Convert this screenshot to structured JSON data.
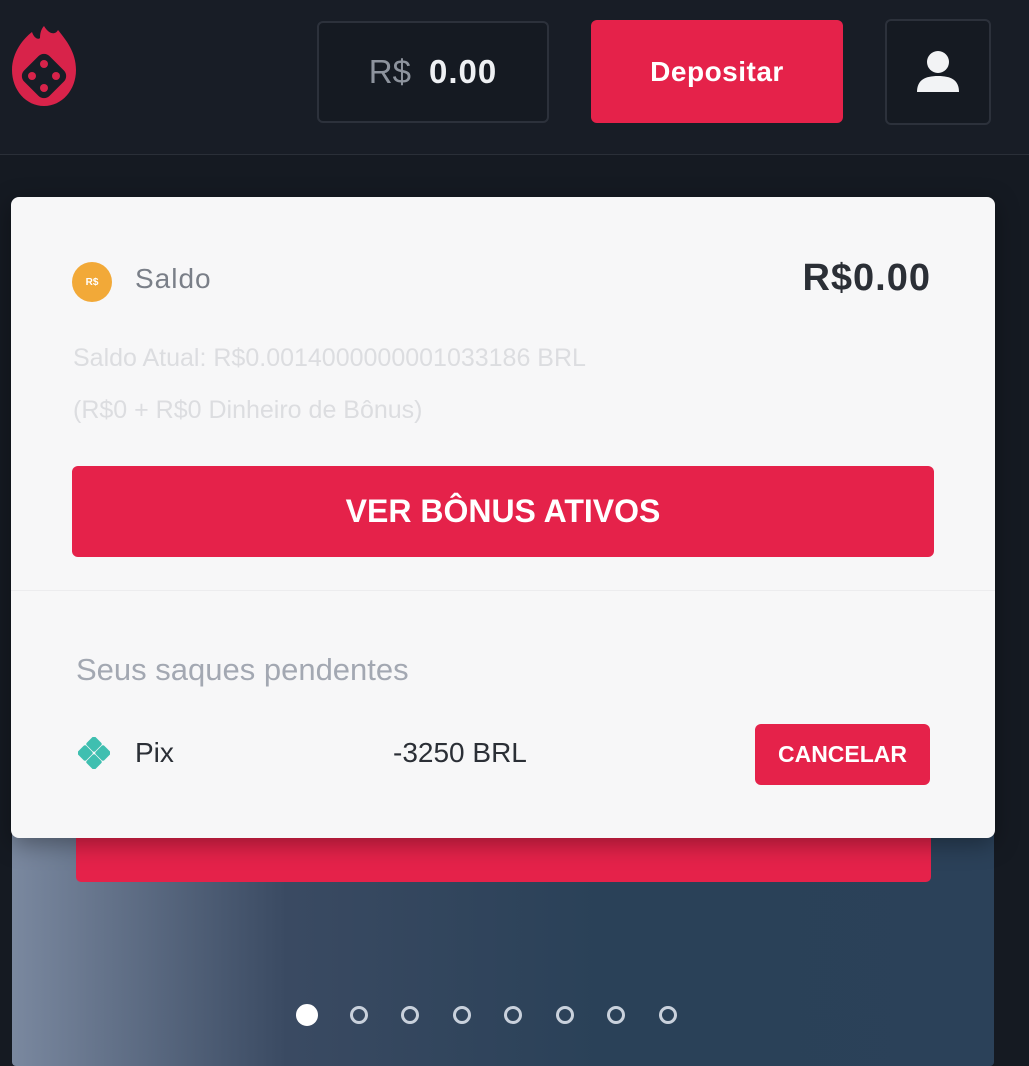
{
  "header": {
    "logo_icon": "fire-dice-icon",
    "balance_currency": "R$",
    "balance_amount": "0.00",
    "deposit_label": "Depositar",
    "user_icon": "user-icon"
  },
  "balance_card": {
    "coin_icon_text": "R$",
    "saldo_label": "Saldo",
    "saldo_value": "R$0.00",
    "current_balance_text": "Saldo Atual: R$0.0014000000001033186 BRL",
    "breakdown_text": "(R$0 + R$0 Dinheiro de Bônus)",
    "bonus_button_label": "VER BÔNUS ATIVOS",
    "pending_title": "Seus saques pendentes",
    "pending_withdrawals": [
      {
        "method": "Pix",
        "icon": "pix-icon",
        "amount": "-3250 BRL",
        "action_label": "CANCELAR"
      }
    ]
  },
  "carousel": {
    "slide_count": 8,
    "active_index": 0
  },
  "colors": {
    "accent": "#e5224a",
    "header_bg": "#181d26",
    "coin": "#f2a938",
    "pix": "#3fbfb0"
  }
}
